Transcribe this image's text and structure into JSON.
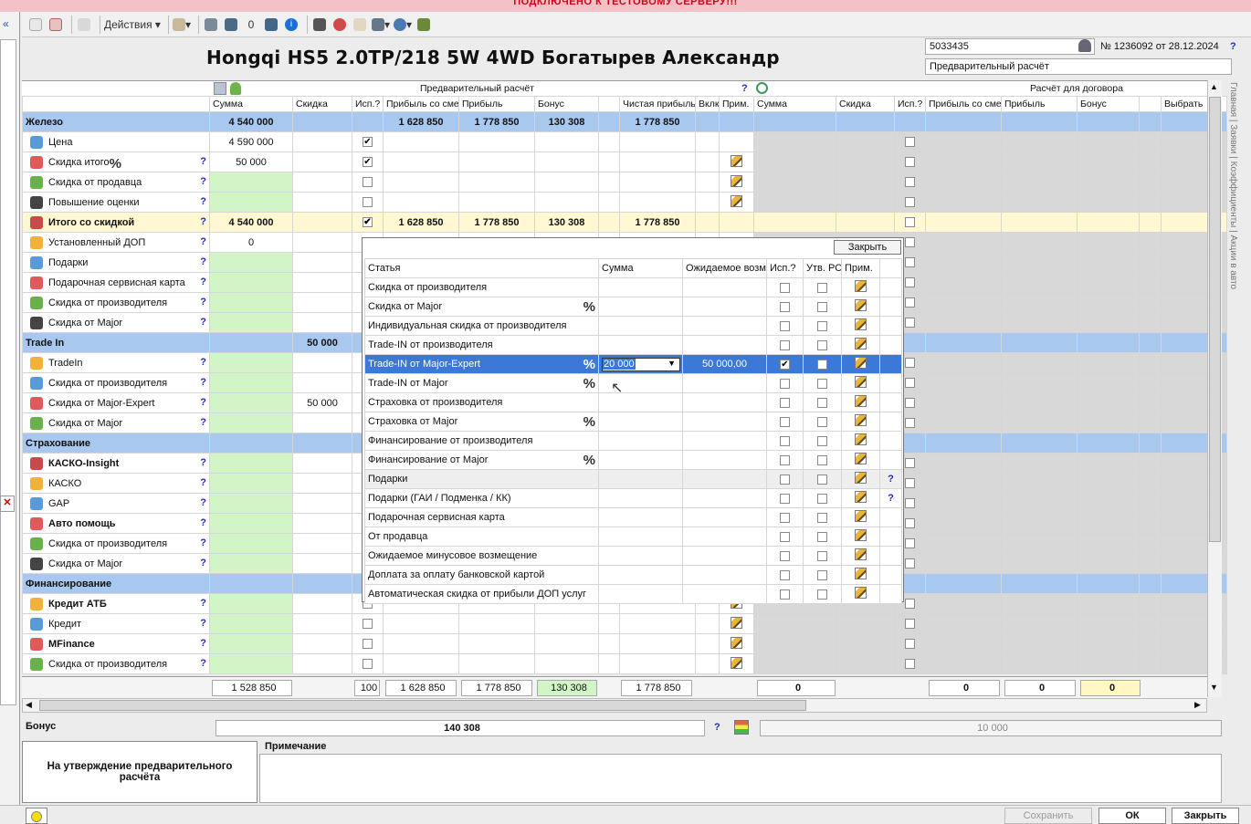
{
  "banner": "ПОДКЛЮЧЕНО К ТЕСТОВОМУ СЕРВЕРУ!!!",
  "toolbar": {
    "actions": "Действия ▾"
  },
  "title": "Hongqi HS5 2.0TP/218 5W 4WD Богатырев Александр",
  "order": {
    "id": "5033435",
    "number": "№ 1236092 от 28.12.2024",
    "mode": "Предварительный расчёт"
  },
  "tabs": "Главная | Заявки | Коэффициенты | Акции в авто",
  "left_header": "Предварительный расчёт",
  "right_header": "Расчёт для договора",
  "cols": [
    "Сумма",
    "Скидка",
    "Исп.?",
    "Прибыль со сме",
    "Прибыль",
    "Бонус",
    "",
    "Чистая прибыль",
    "Вклк",
    "Прим."
  ],
  "rcols": [
    "Сумма",
    "Скидка",
    "Исп.?",
    "Прибыль со сме",
    "Прибыль",
    "Бонус",
    "",
    "Выбрать"
  ],
  "rows": [
    {
      "label": "Железо",
      "type": "sec",
      "sum": "4 540 000",
      "p1": "1 628 850",
      "p2": "1 778 850",
      "bonus": "130 308",
      "net": "1 778 850"
    },
    {
      "label": "Цена",
      "sum": "4 590 000",
      "chk": "✔"
    },
    {
      "label": "Скидка итого",
      "sum": "50 000",
      "chk": "✔",
      "pct": "%",
      "q": "?",
      "pen": 1
    },
    {
      "label": "Скидка от продавца",
      "q": "?",
      "green": 1,
      "pen": 1,
      "cb": 1
    },
    {
      "label": "Повышение оценки",
      "q": "?",
      "green": 1,
      "pen": 1,
      "cb": 1
    },
    {
      "label": "Итого со скидкой",
      "type": "itog",
      "q": "?",
      "sum": "4 540 000",
      "chk": "✔",
      "p1": "1 628 850",
      "p2": "1 778 850",
      "bonus": "130 308",
      "net": "1 778 850"
    },
    {
      "label": "Установленный ДОП",
      "q": "?",
      "sum": "0"
    },
    {
      "label": "Подарки",
      "q": "?",
      "green": 1
    },
    {
      "label": "Подарочная сервисная карта",
      "q": "?",
      "green": 1
    },
    {
      "label": "Скидка от производителя",
      "q": "?",
      "green": 1
    },
    {
      "label": "Скидка от Major",
      "q": "?",
      "green": 1
    },
    {
      "label": "Trade In",
      "type": "sec",
      "disc": "50 000"
    },
    {
      "label": "TradeIn",
      "q": "?",
      "green": 1
    },
    {
      "label": "Скидка от производителя",
      "q": "?",
      "green": 1
    },
    {
      "label": "Скидка от Major-Expert",
      "q": "?",
      "green": 1,
      "disc": "50 000"
    },
    {
      "label": "Скидка от Major",
      "q": "?",
      "green": 1
    },
    {
      "label": "Страхование",
      "type": "sec"
    },
    {
      "label": "КАСКО-Insight",
      "q": "?",
      "green": 1,
      "bold": 1
    },
    {
      "label": "КАСКО",
      "q": "?",
      "green": 1
    },
    {
      "label": "GAP",
      "q": "?",
      "green": 1
    },
    {
      "label": "Авто помощь",
      "q": "?",
      "green": 1,
      "bold": 1
    },
    {
      "label": "Скидка от производителя",
      "q": "?",
      "green": 1
    },
    {
      "label": "Скидка от Major",
      "q": "?",
      "green": 1
    },
    {
      "label": "Финансирование",
      "type": "sec"
    },
    {
      "label": "Кредит АТБ",
      "q": "?",
      "green": 1,
      "bold": 1,
      "cb": 1,
      "pen": 1
    },
    {
      "label": "Кредит",
      "q": "?",
      "green": 1,
      "cb": 1,
      "pen": 1
    },
    {
      "label": "MFinance",
      "q": "?",
      "green": 1,
      "bold": 1,
      "cb": 1,
      "pen": 1
    },
    {
      "label": "Скидка от производителя",
      "q": "?",
      "green": 1,
      "cb": 1,
      "pen": 1
    }
  ],
  "totals": {
    "sum": "1 528 850",
    "pct": "100",
    "p1": "1 628 850",
    "p2": "1 778 850",
    "bonus": "130 308",
    "net": "1 778 850",
    "r1": "0",
    "r2": "0",
    "r3": "0",
    "r4": "0"
  },
  "bonus": {
    "label": "Бонус",
    "value": "140 308",
    "q": "?",
    "right": "10 000"
  },
  "approve": "На утверждение предварительного расчёта",
  "note_label": "Примечание",
  "buttons": {
    "save": "Сохранить",
    "ok": "ОК",
    "close": "Закрыть"
  },
  "popup": {
    "close": "Закрыть",
    "cols": [
      "Статья",
      "Сумма",
      "Ожидаемое возм",
      "Исп.?",
      "Утв. РС",
      "Прим."
    ],
    "rows": [
      {
        "label": "Скидка от производителя"
      },
      {
        "label": "Скидка от Major",
        "pct": "%"
      },
      {
        "label": "Индивидуальная скидка от производителя"
      },
      {
        "label": "Trade-IN от производителя"
      },
      {
        "label": "Trade-IN от Major-Expert",
        "pct": "%",
        "sum": "20 000",
        "exp": "50 000,00",
        "sel": 1
      },
      {
        "label": "Trade-IN от Major",
        "pct": "%"
      },
      {
        "label": "Страховка от производителя"
      },
      {
        "label": "Страховка от Major",
        "pct": "%"
      },
      {
        "label": "Финансирование от производителя"
      },
      {
        "label": "Финансирование от Major",
        "pct": "%"
      },
      {
        "label": "Подарки",
        "grey": 1,
        "q": "?"
      },
      {
        "label": "Подарки (ГАИ / Подменка / КК)",
        "q": "?"
      },
      {
        "label": "Подарочная сервисная карта"
      },
      {
        "label": "От продавца"
      },
      {
        "label": "Ожидаемое минусовое возмещение"
      },
      {
        "label": "Доплата за оплату банковской картой"
      },
      {
        "label": "Автоматическая скидка от прибыли ДОП услуг"
      }
    ]
  }
}
